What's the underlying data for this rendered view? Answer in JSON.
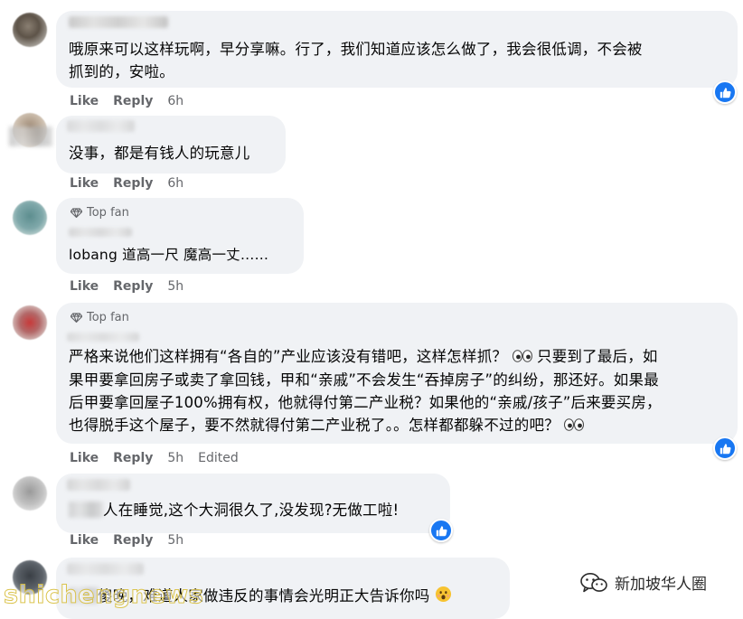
{
  "comments": [
    {
      "text_lines": [
        "哦原来可以这样玩啊，早分享嘛。行了，我们知道应该怎么做了，我会很低调，不会被",
        "抓到的，安啦。"
      ],
      "actions": {
        "like": "Like",
        "reply": "Reply",
        "time": "6h"
      },
      "reaction": "like"
    },
    {
      "text_lines": [
        "没事，都是有钱人的玩意儿"
      ],
      "actions": {
        "like": "Like",
        "reply": "Reply",
        "time": "6h"
      }
    },
    {
      "badge": "Top fan",
      "text_lines": [
        "lobang 道高一尺 魔高一丈……"
      ],
      "actions": {
        "like": "Like",
        "reply": "Reply",
        "time": "5h"
      }
    },
    {
      "badge": "Top fan",
      "text_lines": [
        "严格来说他们这样拥有“各自的”产业应该没有错吧，这样怎样抓？",
        "果甲要拿回房子或卖了拿回钱，甲和“亲戚”不会发生“吞掉房子”的纠纷，那还好。如果最",
        "后甲要拿回屋子100%拥有权，他就得付第二产业税？如果他的“亲戚/孩子”后来要买房，",
        "也得脱手这个屋子，要不然就得付第二产业税了。。怎样都都躲不过的吧？"
      ],
      "line1_suffix": "只要到了最后，如",
      "actions": {
        "like": "Like",
        "reply": "Reply",
        "time": "5h",
        "edited": "Edited"
      },
      "reaction": "like"
    },
    {
      "text_lines": [
        "人在睡觉,这个大洞很久了,没发现?无做工啦!"
      ],
      "actions": {
        "like": "Like",
        "reply": "Reply",
        "time": "5h"
      },
      "reaction": "like"
    },
    {
      "text_lines": [
        "傻晚，难道人家做违反的事情会光明正大告诉你吗"
      ]
    }
  ],
  "watermarks": {
    "left": "shichengnews",
    "right": "新加坡华人圈"
  },
  "colors": {
    "bubble": "#f0f2f5",
    "meta_text": "#65676b",
    "like_blue": "#1877f2"
  },
  "icons": [
    "gem-icon",
    "like-thumb-icon",
    "eyes-emoji-icon",
    "surprised-emoji-icon",
    "wechat-logo-icon"
  ]
}
